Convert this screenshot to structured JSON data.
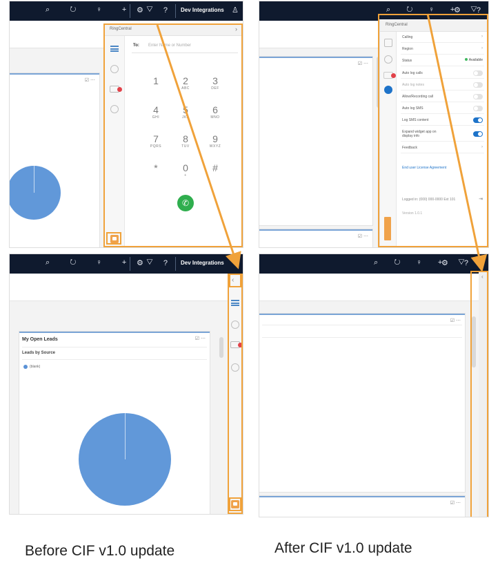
{
  "colors": {
    "highlight": "#f0a23a",
    "topbar": "#0f1a2e",
    "pie": "#6198d9",
    "call": "#2fae4e"
  },
  "topbar": {
    "org_label": "Dev Integrations",
    "icons": [
      "search-icon",
      "refresh-icon",
      "lightbulb-icon",
      "plus-icon",
      "filter-icon",
      "settings-icon",
      "help-icon",
      "user-icon"
    ],
    "glyphs_left": "⌕ ↻ ♀ + ▽",
    "glyphs_right": "⚙ ?",
    "user_glyph": "♙"
  },
  "dialer": {
    "title": "RingCentral",
    "to_label": "To:",
    "to_placeholder": "Enter Name or Number",
    "keys": [
      {
        "digit": "1",
        "letters": ""
      },
      {
        "digit": "2",
        "letters": "ABC"
      },
      {
        "digit": "3",
        "letters": "DEF"
      },
      {
        "digit": "4",
        "letters": "GHI"
      },
      {
        "digit": "5",
        "letters": "JKL"
      },
      {
        "digit": "6",
        "letters": "MNO"
      },
      {
        "digit": "7",
        "letters": "PQRS"
      },
      {
        "digit": "8",
        "letters": "TUV"
      },
      {
        "digit": "9",
        "letters": "WXYZ"
      },
      {
        "digit": "*",
        "letters": ""
      },
      {
        "digit": "0",
        "letters": "+"
      },
      {
        "digit": "#",
        "letters": ""
      }
    ],
    "call_glyph": "✆"
  },
  "settings": {
    "title": "RingCentral",
    "rows": [
      {
        "label": "Calling",
        "kind": "chevron",
        "value": "›"
      },
      {
        "label": "Region",
        "kind": "chevron",
        "value": "›"
      },
      {
        "label": "Status",
        "kind": "status",
        "value": "Available"
      },
      {
        "label": "Auto log calls",
        "kind": "toggle",
        "on": false
      },
      {
        "label": "Auto log notes",
        "kind": "toggle",
        "on": false
      },
      {
        "label": "Allow/Recording call",
        "kind": "toggle",
        "on": false
      },
      {
        "label": "Auto log SMS",
        "kind": "toggle",
        "on": false
      },
      {
        "label": "Log SMS content",
        "kind": "toggle",
        "on": true
      },
      {
        "label": "Expand widget app on display info",
        "kind": "toggle",
        "on": true
      },
      {
        "label": "Feedback",
        "kind": "chevron",
        "value": "›"
      }
    ],
    "eula": "End user License Agreement",
    "logged_in": "Logged in: (000) 000-0000 Ext 101",
    "version": "Version 1.0.1",
    "logout_glyph": "⇥"
  },
  "leads_card": {
    "title": "My Open Leads",
    "subtitle": "Leads by Source",
    "legend": "(blank)"
  },
  "captions": {
    "before": "Before CIF v1.0 update",
    "after": "After CIF v1.0 update"
  }
}
